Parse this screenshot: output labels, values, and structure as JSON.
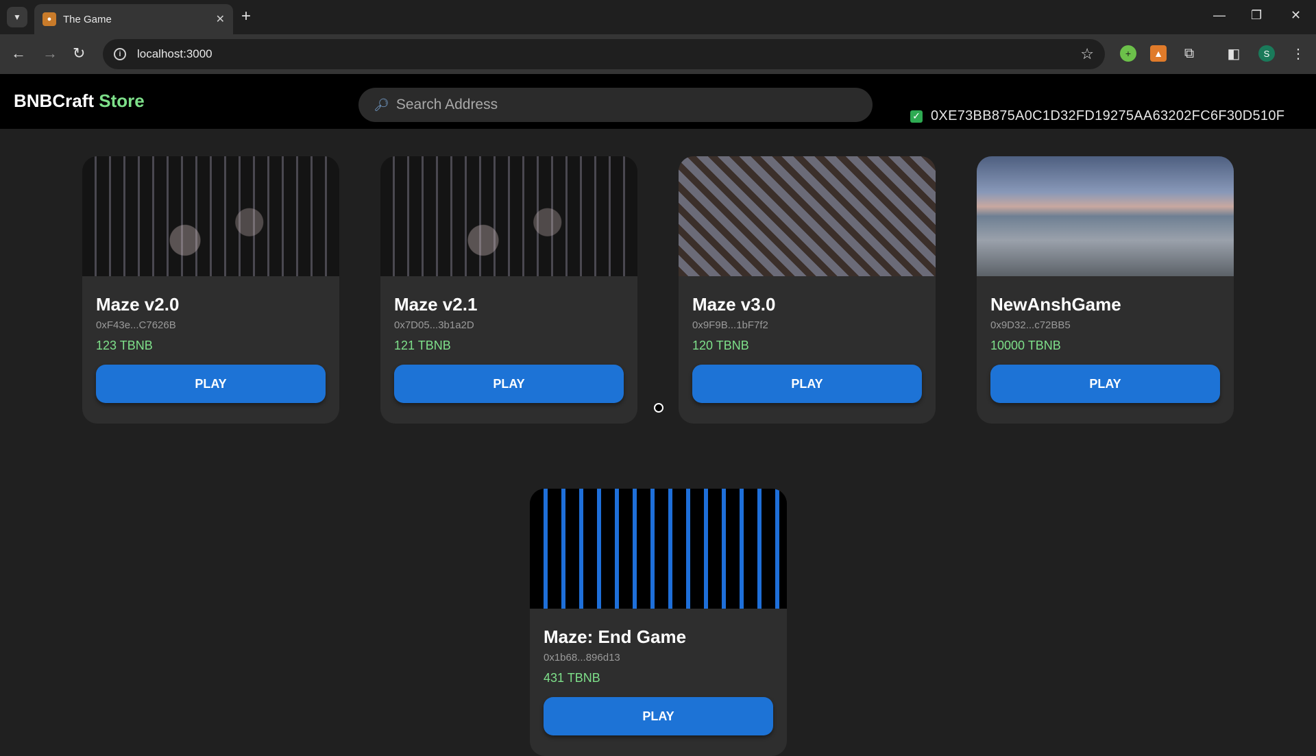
{
  "browser": {
    "tab_title": "The Game",
    "url": "localhost:3000",
    "profile_initial": "S"
  },
  "app": {
    "brand_main": "BNBCraft",
    "brand_accent": "Store",
    "search_placeholder": "Search Address",
    "wallet_address": "0XE73BB875A0C1D32FD19275AA63202FC6F30D510F"
  },
  "colors": {
    "accent_green": "#7ee08a",
    "button_blue": "#1d73d6",
    "card_bg": "#2e2e2e"
  },
  "games": [
    {
      "title": "Maze v2.0",
      "address": "0xF43e...C7626B",
      "price": "123 TBNB",
      "button": "PLAY"
    },
    {
      "title": "Maze v2.1",
      "address": "0x7D05...3b1a2D",
      "price": "121 TBNB",
      "button": "PLAY"
    },
    {
      "title": "Maze v3.0",
      "address": "0x9F9B...1bF7f2",
      "price": "120 TBNB",
      "button": "PLAY"
    },
    {
      "title": "NewAnshGame",
      "address": "0x9D32...c72BB5",
      "price": "10000 TBNB",
      "button": "PLAY"
    },
    {
      "title": "Maze: End Game",
      "address": "0x1b68...896d13",
      "price": "431 TBNB",
      "button": "PLAY"
    }
  ]
}
